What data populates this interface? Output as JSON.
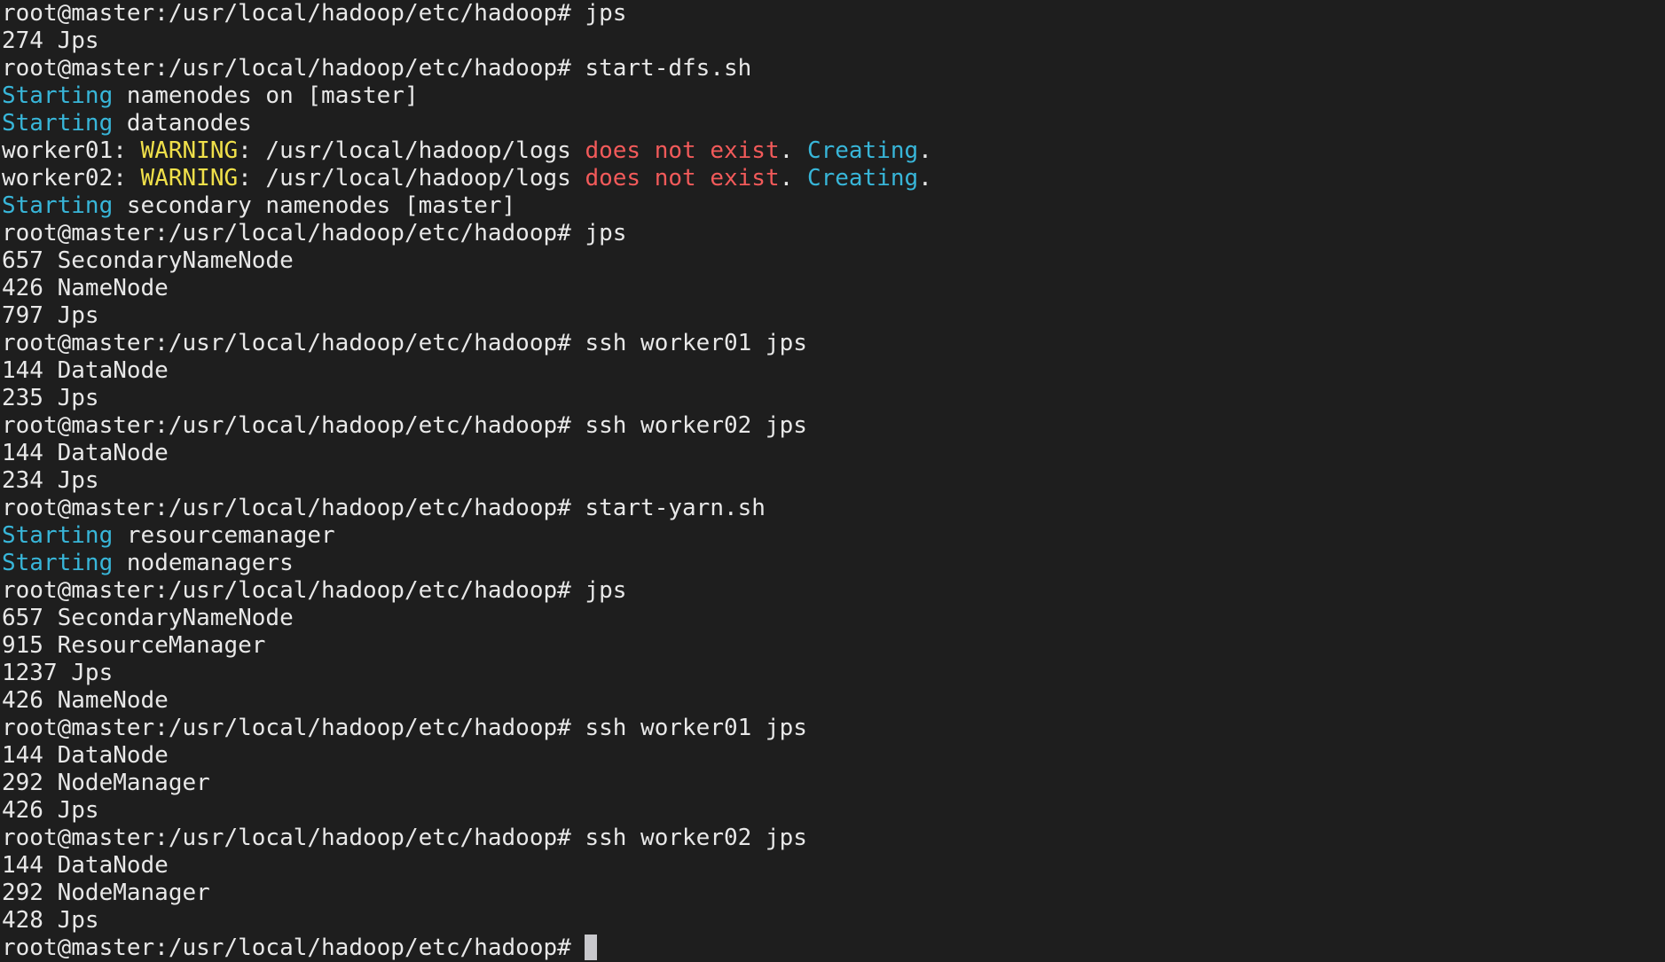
{
  "terminal": {
    "colors": {
      "background": "#1e1e1e",
      "default": "#e8e8e8",
      "cyan": "#38b6d9",
      "yellow": "#f0e04a",
      "red": "#f25a5a",
      "cursor": "#c8c8cc"
    },
    "lines": [
      {
        "segments": [
          {
            "text": "root@master:/usr/local/hadoop/etc/hadoop# jps",
            "color": "default"
          }
        ]
      },
      {
        "segments": [
          {
            "text": "274 Jps",
            "color": "default"
          }
        ]
      },
      {
        "segments": [
          {
            "text": "root@master:/usr/local/hadoop/etc/hadoop# start-dfs.sh",
            "color": "default"
          }
        ]
      },
      {
        "segments": [
          {
            "text": "Starting",
            "color": "cyan"
          },
          {
            "text": " namenodes on [master]",
            "color": "default"
          }
        ]
      },
      {
        "segments": [
          {
            "text": "Starting",
            "color": "cyan"
          },
          {
            "text": " datanodes",
            "color": "default"
          }
        ]
      },
      {
        "segments": [
          {
            "text": "worker01: ",
            "color": "default"
          },
          {
            "text": "WARNING",
            "color": "yellow"
          },
          {
            "text": ": /usr/local/hadoop/logs ",
            "color": "default"
          },
          {
            "text": "does not exist",
            "color": "red"
          },
          {
            "text": ". ",
            "color": "default"
          },
          {
            "text": "Creating",
            "color": "cyan"
          },
          {
            "text": ".",
            "color": "default"
          }
        ]
      },
      {
        "segments": [
          {
            "text": "worker02: ",
            "color": "default"
          },
          {
            "text": "WARNING",
            "color": "yellow"
          },
          {
            "text": ": /usr/local/hadoop/logs ",
            "color": "default"
          },
          {
            "text": "does not exist",
            "color": "red"
          },
          {
            "text": ". ",
            "color": "default"
          },
          {
            "text": "Creating",
            "color": "cyan"
          },
          {
            "text": ".",
            "color": "default"
          }
        ]
      },
      {
        "segments": [
          {
            "text": "Starting",
            "color": "cyan"
          },
          {
            "text": " secondary namenodes [master]",
            "color": "default"
          }
        ]
      },
      {
        "segments": [
          {
            "text": "root@master:/usr/local/hadoop/etc/hadoop# jps",
            "color": "default"
          }
        ]
      },
      {
        "segments": [
          {
            "text": "657 SecondaryNameNode",
            "color": "default"
          }
        ]
      },
      {
        "segments": [
          {
            "text": "426 NameNode",
            "color": "default"
          }
        ]
      },
      {
        "segments": [
          {
            "text": "797 Jps",
            "color": "default"
          }
        ]
      },
      {
        "segments": [
          {
            "text": "root@master:/usr/local/hadoop/etc/hadoop# ssh worker01 jps",
            "color": "default"
          }
        ]
      },
      {
        "segments": [
          {
            "text": "144 DataNode",
            "color": "default"
          }
        ]
      },
      {
        "segments": [
          {
            "text": "235 Jps",
            "color": "default"
          }
        ]
      },
      {
        "segments": [
          {
            "text": "root@master:/usr/local/hadoop/etc/hadoop# ssh worker02 jps",
            "color": "default"
          }
        ]
      },
      {
        "segments": [
          {
            "text": "144 DataNode",
            "color": "default"
          }
        ]
      },
      {
        "segments": [
          {
            "text": "234 Jps",
            "color": "default"
          }
        ]
      },
      {
        "segments": [
          {
            "text": "root@master:/usr/local/hadoop/etc/hadoop# start-yarn.sh",
            "color": "default"
          }
        ]
      },
      {
        "segments": [
          {
            "text": "Starting",
            "color": "cyan"
          },
          {
            "text": " resourcemanager",
            "color": "default"
          }
        ]
      },
      {
        "segments": [
          {
            "text": "Starting",
            "color": "cyan"
          },
          {
            "text": " nodemanagers",
            "color": "default"
          }
        ]
      },
      {
        "segments": [
          {
            "text": "root@master:/usr/local/hadoop/etc/hadoop# jps",
            "color": "default"
          }
        ]
      },
      {
        "segments": [
          {
            "text": "657 SecondaryNameNode",
            "color": "default"
          }
        ]
      },
      {
        "segments": [
          {
            "text": "915 ResourceManager",
            "color": "default"
          }
        ]
      },
      {
        "segments": [
          {
            "text": "1237 Jps",
            "color": "default"
          }
        ]
      },
      {
        "segments": [
          {
            "text": "426 NameNode",
            "color": "default"
          }
        ]
      },
      {
        "segments": [
          {
            "text": "root@master:/usr/local/hadoop/etc/hadoop# ssh worker01 jps",
            "color": "default"
          }
        ]
      },
      {
        "segments": [
          {
            "text": "144 DataNode",
            "color": "default"
          }
        ]
      },
      {
        "segments": [
          {
            "text": "292 NodeManager",
            "color": "default"
          }
        ]
      },
      {
        "segments": [
          {
            "text": "426 Jps",
            "color": "default"
          }
        ]
      },
      {
        "segments": [
          {
            "text": "root@master:/usr/local/hadoop/etc/hadoop# ssh worker02 jps",
            "color": "default"
          }
        ]
      },
      {
        "segments": [
          {
            "text": "144 DataNode",
            "color": "default"
          }
        ]
      },
      {
        "segments": [
          {
            "text": "292 NodeManager",
            "color": "default"
          }
        ]
      },
      {
        "segments": [
          {
            "text": "428 Jps",
            "color": "default"
          }
        ]
      }
    ],
    "prompt": "root@master:/usr/local/hadoop/etc/hadoop# "
  }
}
